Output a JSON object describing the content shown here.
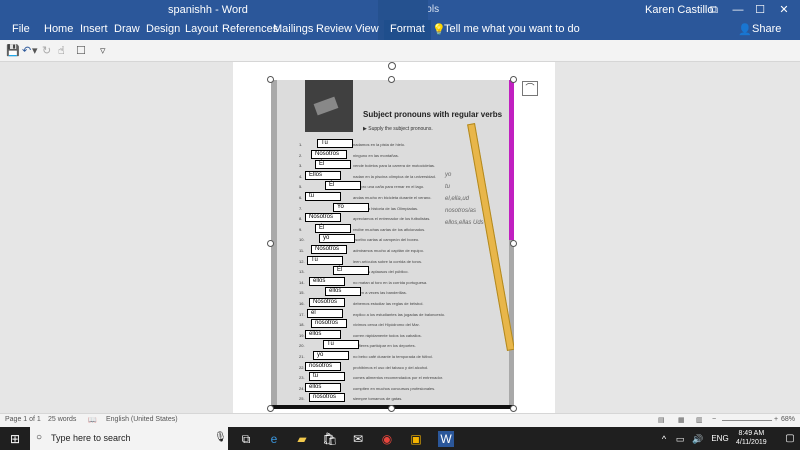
{
  "titlebar": {
    "doc_title": "spanishh  -  Word",
    "context_title": "Picture Tools",
    "user": "Karen Castillo",
    "buttons": {
      "restore": "⧉",
      "minimize": "—",
      "maximize": "☐",
      "close": "✕"
    }
  },
  "ribbon": {
    "tabs": [
      "File",
      "Home",
      "Insert",
      "Draw",
      "Design",
      "Layout",
      "References",
      "Mailings",
      "Review",
      "View",
      "Format"
    ],
    "active_tab": "Format",
    "tell_me": "Tell me what you want to do",
    "share": "Share"
  },
  "qat": {
    "items": [
      "save-icon",
      "undo-icon",
      "redo-icon",
      "touch-mode-icon",
      "checkbox-icon",
      "customize-icon"
    ]
  },
  "document": {
    "worksheet_title": "Subject pronouns with regular verbs",
    "worksheet_subtitle": "▶ Supply the subject pronouns.",
    "rows": [
      {
        "n": "1.",
        "text": "nadamos en la pista de hielo.",
        "label": "Tu"
      },
      {
        "n": "2.",
        "text": "ninguno en las montañas.",
        "label": "Nosotros"
      },
      {
        "n": "3.",
        "text": "vende boletos para la carrera de motocicletas.",
        "label": "Él"
      },
      {
        "n": "4.",
        "text": "nadan en la piscina olímpica de la universidad.",
        "label": "Ellos"
      },
      {
        "n": "5.",
        "text": "compro una caña para remar en el lago.",
        "label": "Él"
      },
      {
        "n": "6.",
        "text": "andas mucho en bicicleta durante el verano.",
        "label": "tu"
      },
      {
        "n": "7.",
        "text": "estudio la historia de las Olimpiadas.",
        "label": "Yo"
      },
      {
        "n": "8.",
        "text": "apreciamos el entrenador de los futbolistas.",
        "label": "Nosotros"
      },
      {
        "n": "9.",
        "text": "recibe muchas cartas de los aficionados.",
        "label": "Él"
      },
      {
        "n": "10.",
        "text": "escribo cartas al campeón del boxeo.",
        "label": "yo"
      },
      {
        "n": "11.",
        "text": "admiramos mucho al capitán de equipo.",
        "label": "Nosotros"
      },
      {
        "n": "12.",
        "text": "leen artículos sobre la corrida de toros.",
        "label": "Tu"
      },
      {
        "n": "13.",
        "text": "recibe los aplausos del público.",
        "label": "Él"
      },
      {
        "n": "14.",
        "text": "no matan al toro en la corrida portuguesa.",
        "label": "ellos"
      },
      {
        "n": "15.",
        "text": "ponen a veces las banderillas.",
        "label": "ellos"
      },
      {
        "n": "16.",
        "text": "debemos estudiar las reglas de béisbol.",
        "label": "Nosotros"
      },
      {
        "n": "17.",
        "text": "explico a los estudiantes las jugadas de baloncesto.",
        "label": "el"
      },
      {
        "n": "18.",
        "text": "vivimos cerca del Hipódromo del Mar.",
        "label": "nosotros"
      },
      {
        "n": "19.",
        "text": "corren rápidamente todos los caballos.",
        "label": "ellos"
      },
      {
        "n": "20.",
        "text": "prefieres participar en los deportes.",
        "label": "Tu"
      },
      {
        "n": "21.",
        "text": "no bebo café durante la temporada de fútbol.",
        "label": "yo"
      },
      {
        "n": "22.",
        "text": "prohibimos el uso del tabaco y del alcohol.",
        "label": "nosotros"
      },
      {
        "n": "23.",
        "text": "comes alimentos recomendados por el entrenador.",
        "label": "tu"
      },
      {
        "n": "24.",
        "text": "compiten en muchos concursos profesionales.",
        "label": "ellos"
      },
      {
        "n": "25.",
        "text": "siempre tomamos de gatas.",
        "label": "nosotros"
      }
    ],
    "notes": [
      "yo",
      "tu",
      "el,ella,ud",
      "nosotros/as",
      "ellos,ellas Uds"
    ]
  },
  "statusbar": {
    "page": "Page 1 of 1",
    "words": "25 words",
    "language": "English (United States)",
    "zoom": "68%"
  },
  "taskbar": {
    "search_placeholder": "Type here to search",
    "time": "8:49 AM",
    "date": "4/11/2019",
    "lang": "ENG"
  },
  "colors": {
    "word_blue": "#2b579a",
    "taskbar": "#1f1f1f"
  }
}
